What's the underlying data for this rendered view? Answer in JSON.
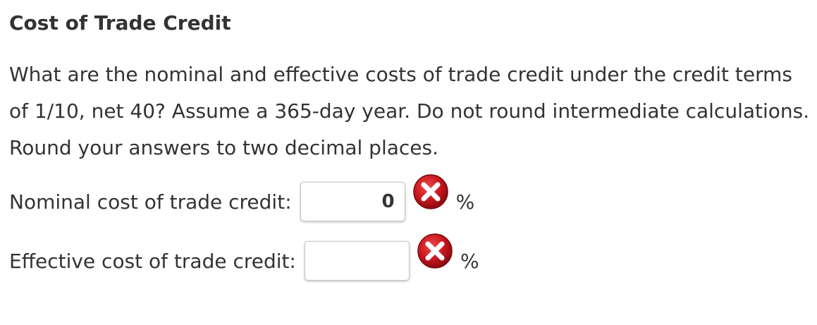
{
  "title": "Cost of Trade Credit",
  "question": "What are the nominal and effective costs of trade credit under the credit terms of 1/10, net 40? Assume a 365-day year. Do not round intermediate calculations. Round your answers to two decimal places.",
  "answers": {
    "nominal": {
      "label": "Nominal cost of trade credit:",
      "value": "0",
      "unit": "%",
      "status_icon": "incorrect-x-icon"
    },
    "effective": {
      "label": "Effective cost of trade credit:",
      "value": "",
      "unit": "%",
      "status_icon": "incorrect-x-icon"
    }
  },
  "colors": {
    "text": "#333333",
    "incorrect_icon": "#c0161e",
    "input_border": "#c8c8c8"
  }
}
